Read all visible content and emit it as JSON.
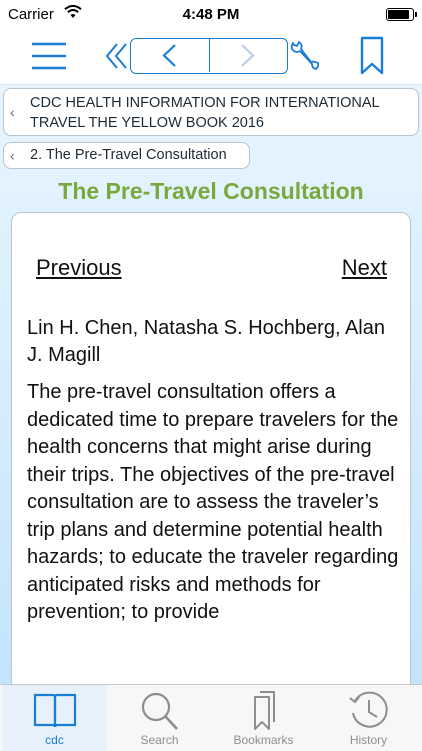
{
  "status_bar": {
    "carrier": "Carrier",
    "time": "4:48 PM",
    "battery_level": 0.95
  },
  "colors": {
    "accent": "#1a7fd4",
    "title_green": "#79a83d",
    "inactive_gray": "#8e8e8e"
  },
  "navbar": {
    "icons": [
      "menu-icon",
      "double-chevron-left-icon",
      "chevron-left-icon",
      "chevron-right-icon",
      "wrench-icon",
      "bookmark-icon"
    ]
  },
  "breadcrumbs": [
    {
      "label": "CDC HEALTH INFORMATION FOR INTERNATIONAL TRAVEL THE YELLOW BOOK 2016"
    },
    {
      "label": "2. The Pre-Travel Consultation"
    }
  ],
  "page_title": "The Pre-Travel Consultation",
  "card": {
    "previous_label": "Previous",
    "next_label": "Next",
    "authors": "Lin H. Chen, Natasha S. Hochberg, Alan J. Magill",
    "paragraph": "The pre-travel consultation offers a dedicated time to prepare travelers for the health concerns that might arise during their trips. The objectives of the pre-travel consultation are to assess the traveler’s trip plans and determine potential health hazards; to educate the traveler regarding anticipated risks and methods for prevention; to provide"
  },
  "tabs": [
    {
      "label": "cdc",
      "icon": "book-icon",
      "active": true
    },
    {
      "label": "Search",
      "icon": "magnifier-icon",
      "active": false
    },
    {
      "label": "Bookmarks",
      "icon": "bookmarks-icon",
      "active": false
    },
    {
      "label": "History",
      "icon": "clock-icon",
      "active": false
    }
  ]
}
